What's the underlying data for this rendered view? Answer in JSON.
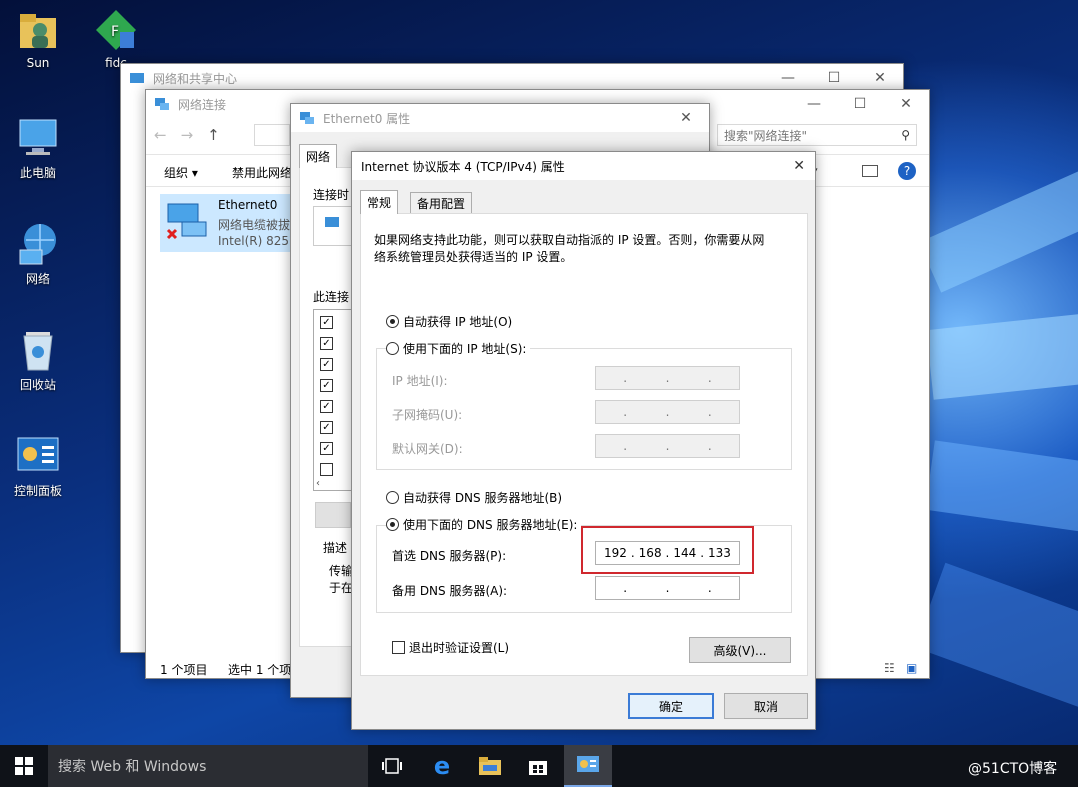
{
  "desktop": {
    "icons": [
      {
        "label": "Sun"
      },
      {
        "label": "fidc"
      },
      {
        "label": "此电脑"
      },
      {
        "label": "网络"
      },
      {
        "label": "回收站"
      },
      {
        "label": "控制面板"
      }
    ]
  },
  "network_center": {
    "title": "网络和共享中心"
  },
  "net_connections": {
    "title": "网络连接",
    "search_placeholder": "搜索\"网络连接\"",
    "toolbar": {
      "organize": "组织 ▾",
      "disable": "禁用此网络"
    },
    "adapter": {
      "name": "Ethernet0",
      "status": "网络电缆被拔",
      "device": "Intel(R) 8257"
    },
    "status_bar": {
      "count": "1 个项目",
      "selected": "选中 1 个项"
    }
  },
  "ethernet_props": {
    "title": "Ethernet0 属性",
    "tab": "网络",
    "connect_using": "连接时",
    "items_label": "此连接",
    "items_checked": [
      true,
      true,
      true,
      true,
      true,
      true,
      true,
      false
    ],
    "description_label": "描述",
    "description_text_1": "传输",
    "description_text_2": "于在"
  },
  "ipv4_dialog": {
    "title": "Internet 协议版本 4 (TCP/IPv4) 属性",
    "close": "✕",
    "tabs": {
      "general": "常规",
      "alternate": "备用配置"
    },
    "intro_1": "如果网络支持此功能，则可以获取自动指派的 IP 设置。否则，你需要从网",
    "intro_2": "络系统管理员处获得适当的 IP 设置。",
    "auto_ip": "自动获得 IP 地址(O)",
    "manual_ip": "使用下面的 IP 地址(S):",
    "ip_label": "IP 地址(I):",
    "mask_label": "子网掩码(U):",
    "gateway_label": "默认网关(D):",
    "auto_dns": "自动获得 DNS 服务器地址(B)",
    "manual_dns": "使用下面的 DNS 服务器地址(E):",
    "preferred_dns_label": "首选 DNS 服务器(P):",
    "preferred_dns": [
      "192",
      "168",
      "144",
      "133"
    ],
    "alternate_dns_label": "备用 DNS 服务器(A):",
    "validate": "退出时验证设置(L)",
    "advanced": "高级(V)...",
    "ok": "确定",
    "cancel": "取消",
    "highlight_color": "#d0282e"
  },
  "taskbar": {
    "search_placeholder": "搜索 Web 和 Windows",
    "watermark": "@51CTO博客"
  }
}
